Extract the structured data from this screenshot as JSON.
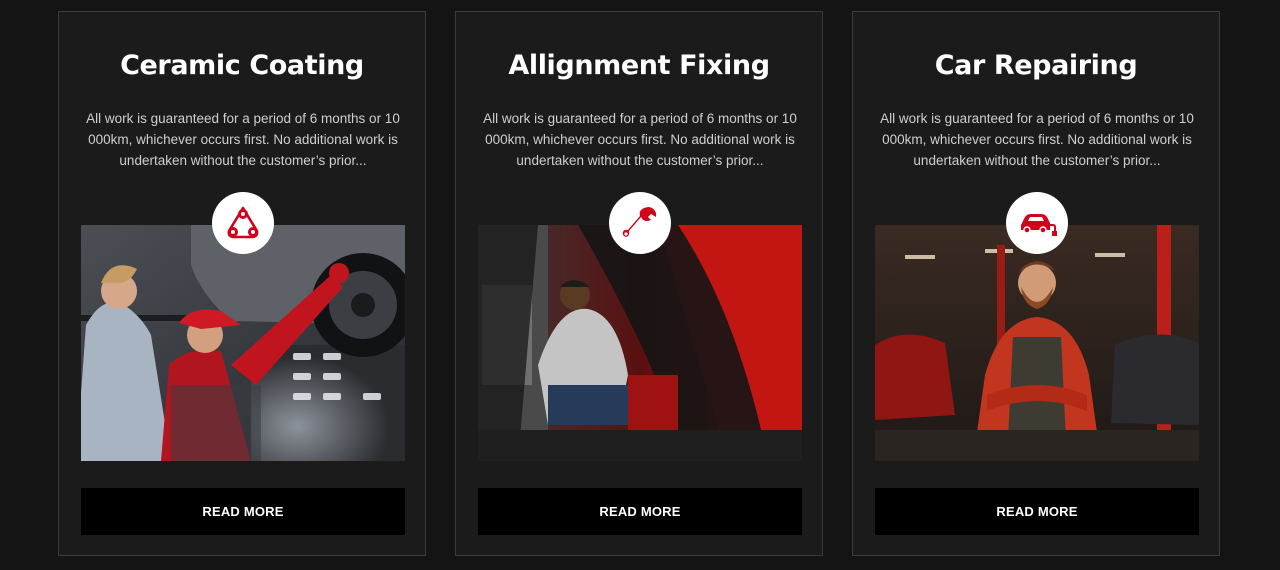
{
  "services": [
    {
      "title": "Ceramic Coating",
      "description": "All work is guaranteed for a period of 6 months or 10 000km, whichever occurs first. No additional work is undertaken without the customer’s prior...",
      "icon": "belt-pulley-icon",
      "button_label": "READ MORE"
    },
    {
      "title": "Allignment Fixing",
      "description": "All work is guaranteed for a period of 6 months or 10 000km, whichever occurs first. No additional work is undertaken without the customer’s prior...",
      "icon": "wrench-icon",
      "button_label": "READ MORE"
    },
    {
      "title": "Car Repairing",
      "description": "All work is guaranteed for a period of 6 months or 10 000km, whichever occurs first. No additional work is undertaken without the customer’s prior...",
      "icon": "electric-car-icon",
      "button_label": "READ MORE"
    }
  ],
  "colors": {
    "accent": "#d0021b",
    "card_bg": "#1b1b1b",
    "page_bg": "#141414",
    "button_bg": "#000000"
  }
}
